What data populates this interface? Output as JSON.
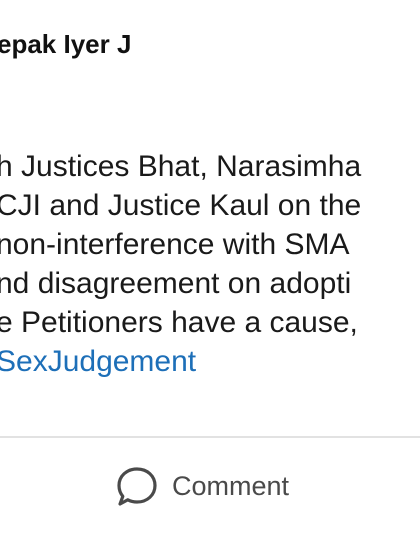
{
  "post": {
    "author_name": "epak Iyer J",
    "lines": [
      "h Justices Bhat, Narasimha",
      "CJI and Justice Kaul on the",
      "non-interference with SMA",
      "nd disagreement on adopti",
      "e Petitioners have a cause,"
    ],
    "hashtag": "SexJudgement"
  },
  "actions": {
    "comment_label": "Comment",
    "comment_icon": "comment-bubble-icon"
  },
  "colors": {
    "hashtag": "#1d6fb8",
    "divider": "#e2e2e2",
    "action_text": "#4a4a4a"
  }
}
